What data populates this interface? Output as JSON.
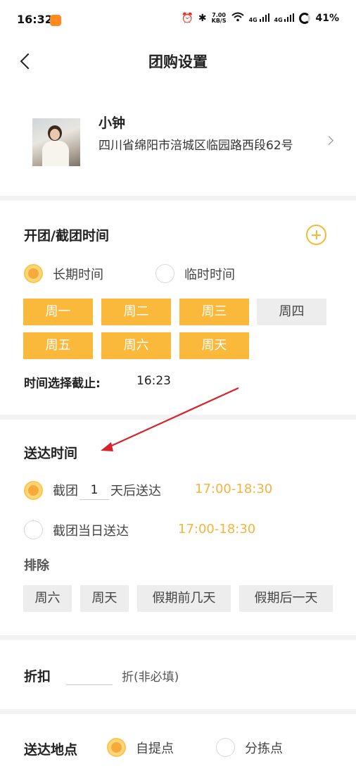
{
  "status_bar": {
    "time": "16:32",
    "speed_top": "7.00",
    "speed_unit": "KB/S",
    "network_a": "4G",
    "network_b": "4G",
    "battery": "41%"
  },
  "nav": {
    "title": "团购设置"
  },
  "profile": {
    "name": "小钟",
    "address": "四川省绵阳市涪城区临园路西段62号"
  },
  "schedule": {
    "title": "开团/截团时间",
    "options": [
      {
        "label": "长期时间",
        "selected": true
      },
      {
        "label": "临时时间",
        "selected": false
      }
    ],
    "days": [
      {
        "label": "周一",
        "selected": true
      },
      {
        "label": "周二",
        "selected": true
      },
      {
        "label": "周三",
        "selected": true
      },
      {
        "label": "周四",
        "selected": false
      },
      {
        "label": "周五",
        "selected": true
      },
      {
        "label": "周六",
        "selected": true
      },
      {
        "label": "周天",
        "selected": true
      }
    ],
    "deadline_label": "时间选择截止:",
    "deadline_value": "16:23"
  },
  "delivery": {
    "title": "送达时间",
    "option1": {
      "prefix": "截团",
      "days": "1",
      "suffix": "天后送达",
      "time": "17:00-18:30",
      "selected": true
    },
    "option2": {
      "label": "截团当日送达",
      "time": "17:00-18:30",
      "selected": false
    },
    "exclude_label": "排除",
    "exclude_options": [
      "周六",
      "周天",
      "假期前几天",
      "假期后一天"
    ]
  },
  "discount": {
    "label": "折扣",
    "value": "",
    "hint": "折(非必填)"
  },
  "location": {
    "label": "送达地点",
    "options": [
      {
        "label": "自提点",
        "selected": true
      },
      {
        "label": "分拣点",
        "selected": false
      }
    ]
  },
  "colors": {
    "accent": "#fbb93c",
    "accent_text": "#f4b43c",
    "annotation_arrow": "#d9232a"
  }
}
